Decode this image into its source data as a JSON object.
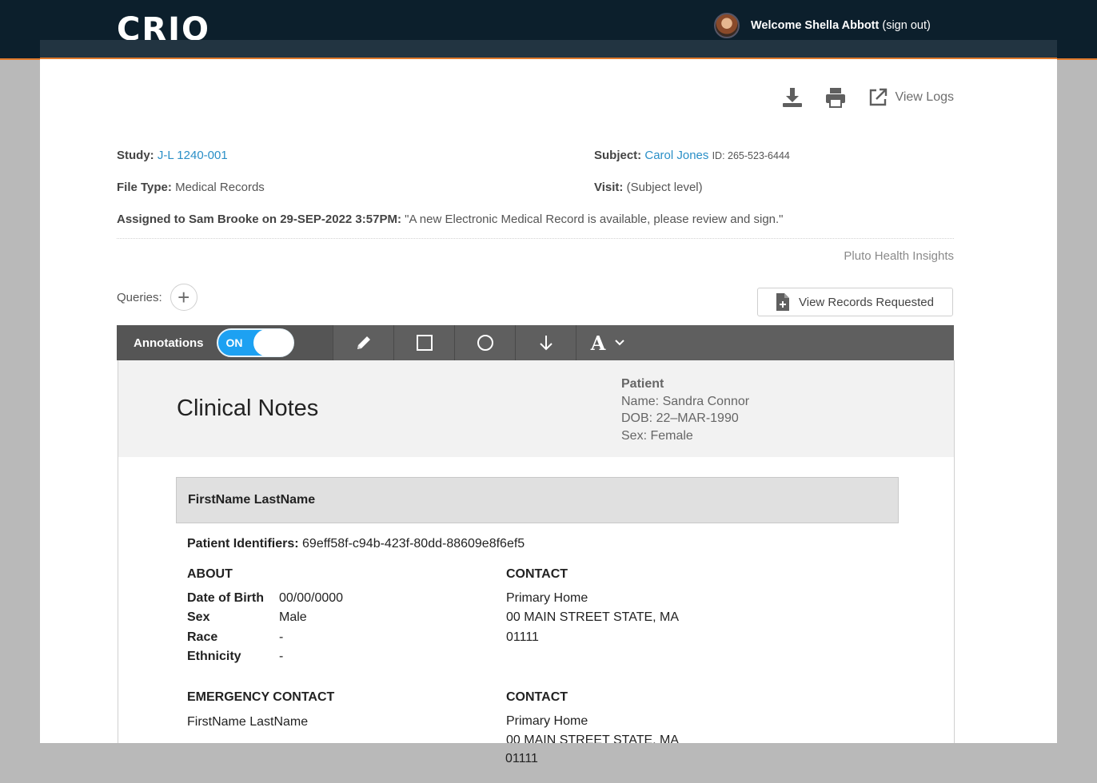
{
  "nav": {
    "logo": "CRIO",
    "welcome": "Welcome Shella Abbott",
    "sign_out": "(sign out)"
  },
  "toolbar": {
    "download_icon": "download-icon",
    "print_icon": "print-icon",
    "external_link_icon": "external-link-icon",
    "view_logs": "View Logs"
  },
  "meta": {
    "study_label": "Study:",
    "study_value": "J-L 1240-001",
    "subject_label": "Subject:",
    "subject_value": "Carol Jones",
    "subject_id": "ID: 265-523-6444",
    "file_type_label": "File Type:",
    "file_type_value": "Medical Records",
    "visit_label": "Visit:",
    "visit_value": "(Subject level)",
    "assigned_label": "Assigned to Sam Brooke on 29-SEP-2022 3:57PM:",
    "assigned_message": "\"A new Electronic Medical Record is available, please review and sign.\"",
    "pluto": "Pluto Health Insights"
  },
  "queries": {
    "label": "Queries:",
    "add": "+"
  },
  "view_records_requested": "View Records Requested",
  "annotations": {
    "label": "Annotations",
    "toggle_state": "ON",
    "tools": [
      "pencil-icon",
      "rectangle-icon",
      "circle-icon",
      "arrow-down-icon",
      "text-icon"
    ],
    "text_tool_label": "A",
    "text_tool_chevron": "⌄"
  },
  "document": {
    "title": "Clinical Notes",
    "patient_heading": "Patient",
    "patient_name": "Name: Sandra Connor",
    "patient_dob": "DOB: 22–MAR-1990",
    "patient_sex": "Sex: Female",
    "name_box": "FirstName LastName",
    "identifiers_label": "Patient Identifiers:",
    "identifiers_value": "69eff58f-c94b-423f-80dd-88609e8f6ef5",
    "about": {
      "title": "ABOUT",
      "rows": [
        {
          "k": "Date of Birth",
          "v": "00/00/0000"
        },
        {
          "k": "Sex",
          "v": "Male"
        },
        {
          "k": "Race",
          "v": "-"
        },
        {
          "k": "Ethnicity",
          "v": "-"
        }
      ]
    },
    "contact": {
      "title": "CONTACT",
      "line1": "Primary Home",
      "line2": "00 MAIN STREET STATE, MA",
      "line3": "01111"
    },
    "emergency": {
      "title": "EMERGENCY CONTACT",
      "name": "FirstName LastName"
    },
    "contact2": {
      "title": "CONTACT",
      "line1": "Primary Home",
      "line2": "00 MAIN STREET STATE, MA",
      "line3": "01111"
    }
  }
}
